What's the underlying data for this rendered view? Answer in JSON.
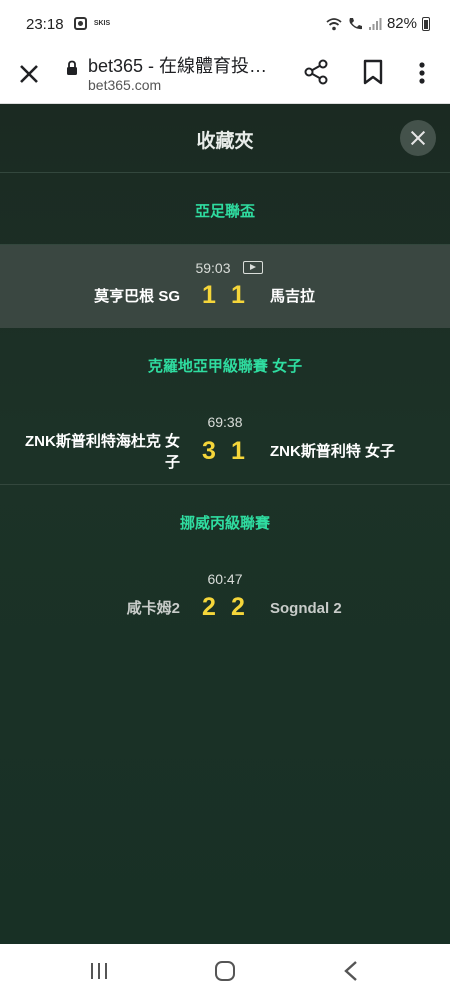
{
  "status_bar": {
    "time": "23:18",
    "skis_label": "SKIS",
    "battery": "82%"
  },
  "browser": {
    "title": "bet365 - 在線體育投…",
    "url": "bet365.com",
    "icons": [
      "close-icon",
      "lock-icon",
      "share-icon",
      "bookmark-icon",
      "more-vert-icon"
    ]
  },
  "favourites": {
    "title": "收藏夾",
    "competitions": [
      {
        "name": "亞足聯盃",
        "match": {
          "time": "59:03",
          "has_video": true,
          "home": "莫亨巴根 SG",
          "home_score": "1",
          "away_score": "1",
          "away": "馬吉拉"
        }
      },
      {
        "name": "克羅地亞甲級聯賽 女子",
        "match": {
          "time": "69:38",
          "has_video": false,
          "home_line1": "ZNK斯普利特海杜克 女",
          "home_line2": "子",
          "home_score": "3",
          "away_score": "1",
          "away": "ZNK斯普利特 女子"
        }
      },
      {
        "name": "挪威丙級聯賽",
        "match": {
          "time": "60:47",
          "has_video": false,
          "home": "咸卡姆2",
          "home_score": "2",
          "away_score": "2",
          "away": "Sogndal 2"
        }
      }
    ]
  },
  "colors": {
    "accent_green": "#2fdca0",
    "score_yellow": "#f5d63a",
    "background": "#1c3227"
  }
}
